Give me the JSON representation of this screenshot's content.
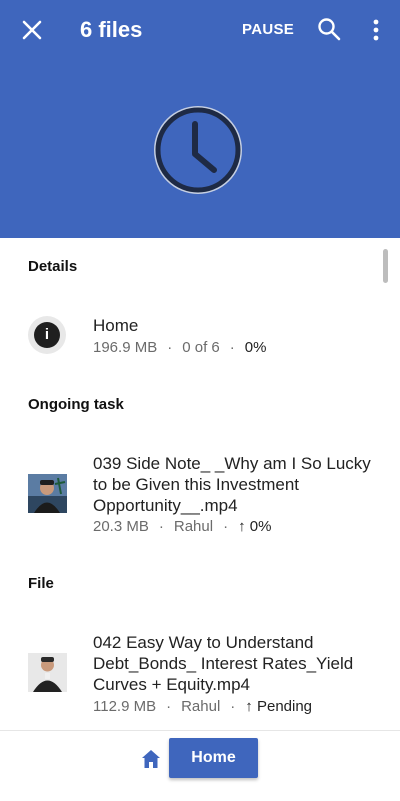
{
  "header": {
    "title": "6 files",
    "pause_label": "PAUSE",
    "bg_color": "#3f66bd",
    "icons": {
      "close": "close-icon",
      "search": "search-icon",
      "more": "more-vert-icon",
      "hero": "clock-icon"
    }
  },
  "details": {
    "heading": "Details",
    "item": {
      "title": "Home",
      "size": "196.9 MB",
      "count": "0 of  6",
      "percent": "0%"
    }
  },
  "ongoing": {
    "heading": "Ongoing task",
    "item": {
      "title": "039 Side Note_ _Why am I So Lucky to be Given this Investment Opportunity__.mp4",
      "size": "20.3 MB",
      "owner": "Rahul",
      "status": "0%"
    }
  },
  "file": {
    "heading": "File",
    "item": {
      "title": "042 Easy Way to Understand Debt_Bonds_ Interest Rates_Yield Curves + Equity.mp4",
      "size": "112.9 MB",
      "owner": "Rahul",
      "status": "Pending"
    }
  },
  "bottom": {
    "home_label": "Home"
  },
  "separator": "·",
  "arrow": "↑"
}
